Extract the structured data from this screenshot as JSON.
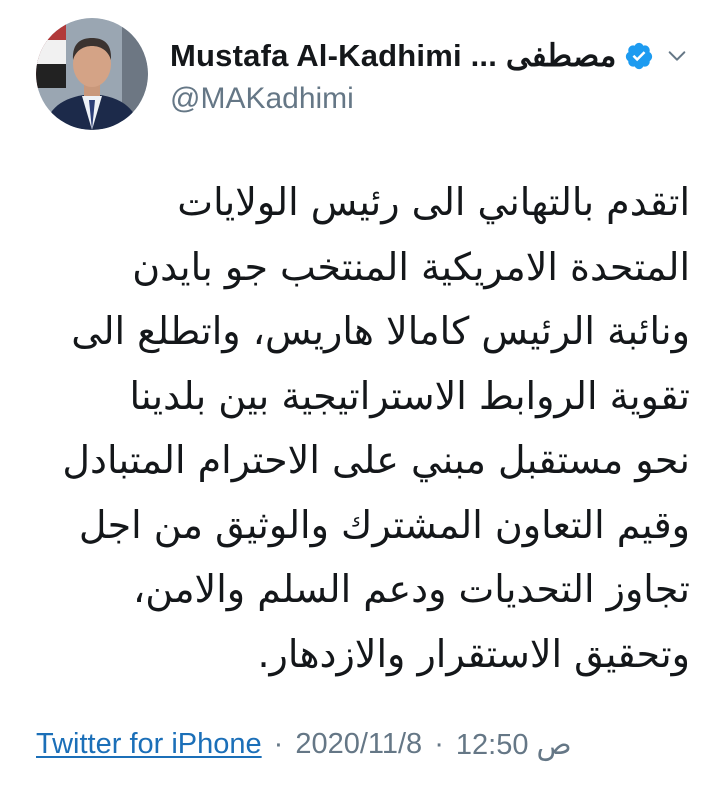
{
  "tweet": {
    "author": {
      "display_name": "Mustafa Al-Kadhimi ... مصطفى",
      "handle": "@MAKadhimi",
      "verified": true,
      "avatar_icon": "profile-photo"
    },
    "header_icons": {
      "verified": "verified-badge-icon",
      "menu": "chevron-down-icon"
    },
    "text_lines": [
      "اتقدم بالتهاني الى رئيس الولايات",
      "المتحدة الامريكية المنتخب جو بايدن",
      "ونائبة الرئيس كامالا هاريس، واتطلع الى",
      "تقوية الروابط الاستراتيجية بين بلدينا",
      "نحو مستقبل مبني على الاحترام المتبادل",
      "وقيم التعاون المشترك والوثيق من اجل",
      "تجاوز التحديات ودعم السلم والامن،",
      "وتحقيق الاستقرار والازدهار."
    ],
    "footer": {
      "source": "Twitter for iPhone",
      "separator": "·",
      "date": "2020/11/8",
      "time": "12:50 ص"
    }
  },
  "colors": {
    "text": "#14171a",
    "muted": "#657786",
    "link": "#1b6fb8",
    "verified": "#1d9bf0"
  }
}
